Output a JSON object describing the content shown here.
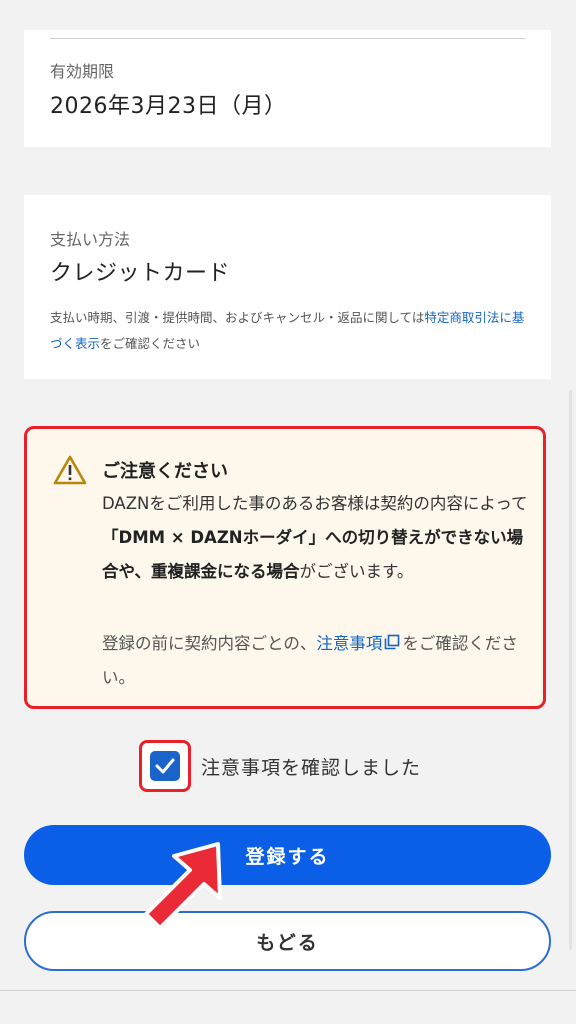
{
  "expiry": {
    "label": "有効期限",
    "value": "2026年3月23日（月）"
  },
  "payment": {
    "label": "支払い方法",
    "value": "クレジットカード",
    "note_prefix": "支払い時期、引渡・提供時間、およびキャンセル・返品に関しては",
    "note_link": "特定商取引法に基づく表示",
    "note_suffix": "をご確認ください"
  },
  "notice": {
    "icon": "warning-icon",
    "title": "ご注意ください",
    "body_part1": "DAZNをご利用した事のあるお客様は契約の内容によって",
    "body_bold": "「DMM × DAZNホーダイ」への切り替えができない場合や、重複課金になる場合",
    "body_part2": "がございます。",
    "confirm_prefix": "登録の前に契約内容ごとの、",
    "confirm_link": "注意事項",
    "confirm_suffix": "をご確認ください。",
    "colors": {
      "border": "#e8202a",
      "background": "#fdf7ec",
      "link": "#1565c0"
    }
  },
  "agreement": {
    "label": "注意事項を確認しました",
    "checked": true
  },
  "buttons": {
    "register": "登録する",
    "back": "もどる",
    "colors": {
      "primary": "#0a5fe6",
      "secondary_border": "#2a6fd0"
    }
  }
}
